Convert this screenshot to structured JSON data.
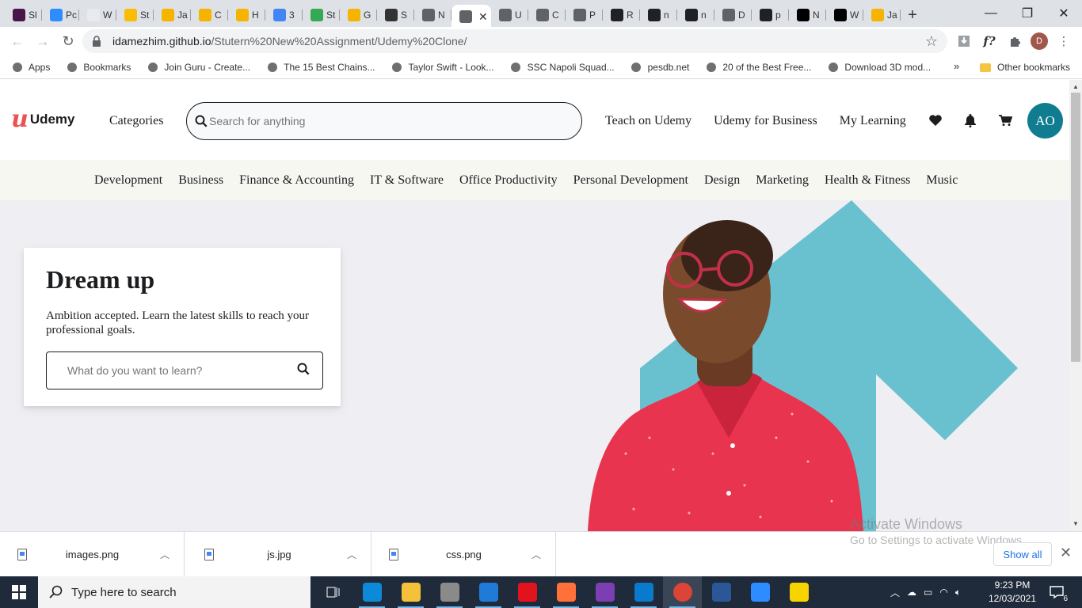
{
  "browser": {
    "tabs": [
      {
        "label": "Sl",
        "color": "#4a154b",
        "icon": "slack-icon"
      },
      {
        "label": "Pc",
        "color": "#2d8cff",
        "icon": "zoom-icon"
      },
      {
        "label": "W",
        "color": "#e8eaed",
        "icon": "rainbow-icon"
      },
      {
        "label": "St",
        "color": "#fbbc04",
        "icon": "drive-icon"
      },
      {
        "label": "Ja",
        "color": "#f4b400",
        "icon": "slides-icon"
      },
      {
        "label": "C",
        "color": "#f4b400",
        "icon": "slides-icon"
      },
      {
        "label": "H",
        "color": "#f4b400",
        "icon": "slides-icon"
      },
      {
        "label": "3",
        "color": "#4285f4",
        "icon": "docs-icon"
      },
      {
        "label": "St",
        "color": "#34a853",
        "icon": "drive-icon"
      },
      {
        "label": "G",
        "color": "#f4b400",
        "icon": "slides-icon"
      },
      {
        "label": "S",
        "color": "#333333",
        "icon": "factory-icon"
      },
      {
        "label": "N",
        "color": "#5f6368",
        "icon": "globe-icon"
      },
      {
        "label": "",
        "color": "#5f6368",
        "icon": "globe-icon",
        "active": true,
        "close": "✕"
      },
      {
        "label": "U",
        "color": "#5f6368",
        "icon": "globe-icon"
      },
      {
        "label": "C",
        "color": "#5f6368",
        "icon": "globe-icon"
      },
      {
        "label": "P",
        "color": "#5f6368",
        "icon": "globe-icon"
      },
      {
        "label": "R",
        "color": "#202124",
        "icon": "github-icon"
      },
      {
        "label": "n",
        "color": "#202124",
        "icon": "github-icon"
      },
      {
        "label": "n",
        "color": "#202124",
        "icon": "github-icon"
      },
      {
        "label": "D",
        "color": "#5f6368",
        "icon": "globe-icon"
      },
      {
        "label": "p",
        "color": "#202124",
        "icon": "github-icon"
      },
      {
        "label": "N",
        "color": "#000000",
        "icon": "notion-icon"
      },
      {
        "label": "W",
        "color": "#000000",
        "icon": "webflow-icon"
      },
      {
        "label": "Ja",
        "color": "#f4b400",
        "icon": "slides-icon"
      }
    ],
    "new_tab": "+",
    "window_controls": {
      "minimize": "—",
      "restore": "❐",
      "close": "✕"
    },
    "url_host": "idamezhim.github.io",
    "url_path": "/Stutern%20New%20Assignment/Udemy%20Clone/",
    "profile_initial": "D",
    "bookmarks": [
      {
        "label": "Apps",
        "icon": "apps-grid-icon"
      },
      {
        "label": "Bookmarks",
        "icon": "star-icon"
      },
      {
        "label": "Join Guru - Create...",
        "icon": "guru-icon"
      },
      {
        "label": "The 15 Best Chains...",
        "icon": "b-logo-icon"
      },
      {
        "label": "Taylor Swift - Look...",
        "icon": "lungs-icon"
      },
      {
        "label": "SSC Napoli Squad...",
        "icon": "soccer-icon"
      },
      {
        "label": "pesdb.net",
        "icon": "globe-icon"
      },
      {
        "label": "20 of the Best Free...",
        "icon": "dark-logo-icon"
      },
      {
        "label": "Download 3D mod...",
        "icon": "sphere-icon"
      }
    ],
    "bookmarks_more": "»",
    "other_bookmarks": "Other bookmarks"
  },
  "udemy": {
    "logo_mark": "u",
    "logo_word": "Udemy",
    "categories": "Categories",
    "search_placeholder": "Search for anything",
    "nav_links": [
      "Teach on Udemy",
      "Udemy for Business",
      "My Learning"
    ],
    "icons": [
      "heart-icon",
      "bell-icon",
      "cart-icon"
    ],
    "avatar_initials": "AO",
    "avatar_color": "#0f7c90",
    "subnav": [
      "Development",
      "Business",
      "Finance & Accounting",
      "IT & Software",
      "Office Productivity",
      "Personal Development",
      "Design",
      "Marketing",
      "Health & Fitness",
      "Music"
    ],
    "hero": {
      "title": "Dream up",
      "text": "Ambition accepted. Learn the latest skills to reach your professional goals.",
      "search_placeholder": "What do you want to learn?",
      "accent_color": "#69c1d0",
      "shirt_color": "#e8344e"
    }
  },
  "downloads": {
    "items": [
      {
        "name": "images.png"
      },
      {
        "name": "js.jpg"
      },
      {
        "name": "css.png"
      }
    ],
    "show_all": "Show all",
    "close": "✕"
  },
  "watermark": {
    "title": "Activate Windows",
    "subtitle": "Go to Settings to activate Windows."
  },
  "taskbar": {
    "search_placeholder": "Type here to search",
    "apps": [
      {
        "name": "task-view-icon",
        "color": "#1f2a3a"
      },
      {
        "name": "edge-icon",
        "color": "#0c8ad8"
      },
      {
        "name": "file-explorer-icon",
        "color": "#f3c13a"
      },
      {
        "name": "store-icon",
        "color": "#8a8a8a"
      },
      {
        "name": "mail-icon",
        "color": "#1f7ad8"
      },
      {
        "name": "opera-icon",
        "color": "#e1141e"
      },
      {
        "name": "firefox-icon",
        "color": "#ff7139"
      },
      {
        "name": "github-desktop-icon",
        "color": "#7b3fb3"
      },
      {
        "name": "vscode-icon",
        "color": "#0a7acc"
      },
      {
        "name": "chrome-icon",
        "color": "#db4437"
      },
      {
        "name": "app-blue-icon",
        "color": "#2b5797"
      },
      {
        "name": "zoom-icon",
        "color": "#2d8cff"
      },
      {
        "name": "sticky-notes-icon",
        "color": "#f7d300"
      }
    ],
    "time": "9:23 PM",
    "date": "12/03/2021",
    "notification_count": "6"
  }
}
